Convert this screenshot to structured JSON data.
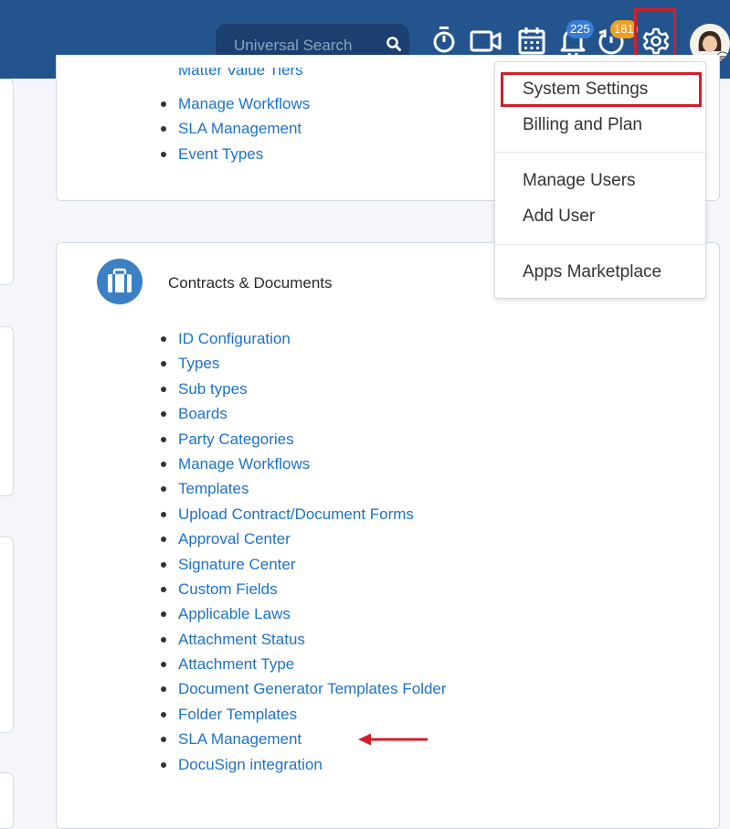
{
  "header": {
    "search": {
      "placeholder": "Universal Search"
    },
    "icons": [
      "search-icon",
      "stopwatch-icon",
      "video-icon",
      "calendar-icon",
      "bell-icon",
      "reminder-icon",
      "gear-icon",
      "avatar"
    ],
    "notifications_count": "225",
    "reminders_count": "181",
    "colors": {
      "bar": "#24548e",
      "search_bg": "#1b3f6e",
      "badge_blue": "#3a7bd5",
      "badge_orange": "#f0a020",
      "highlight": "#d0202a"
    }
  },
  "settings_menu": {
    "items": [
      {
        "label": "System Settings"
      },
      {
        "label": "Billing and Plan"
      },
      {
        "label": "Manage Users"
      },
      {
        "label": "Add User"
      },
      {
        "label": "Apps Marketplace"
      }
    ]
  },
  "section_top": {
    "cut_item": "Matter Value Tiers",
    "links": [
      "Manage Workflows",
      "SLA Management",
      "Event Types"
    ]
  },
  "section_contracts": {
    "icon": "briefcase-icon",
    "title": "Contracts & Documents",
    "links": [
      "ID Configuration",
      "Types",
      "Sub types",
      "Boards",
      "Party Categories",
      "Manage Workflows",
      "Templates",
      "Upload Contract/Document Forms",
      "Approval Center",
      "Signature Center",
      "Custom Fields",
      "Applicable Laws",
      "Attachment Status",
      "Attachment Type",
      "Document Generator Templates Folder",
      "Folder Templates",
      "SLA Management",
      "DocuSign integration"
    ]
  },
  "link_color": "#1d72c8"
}
